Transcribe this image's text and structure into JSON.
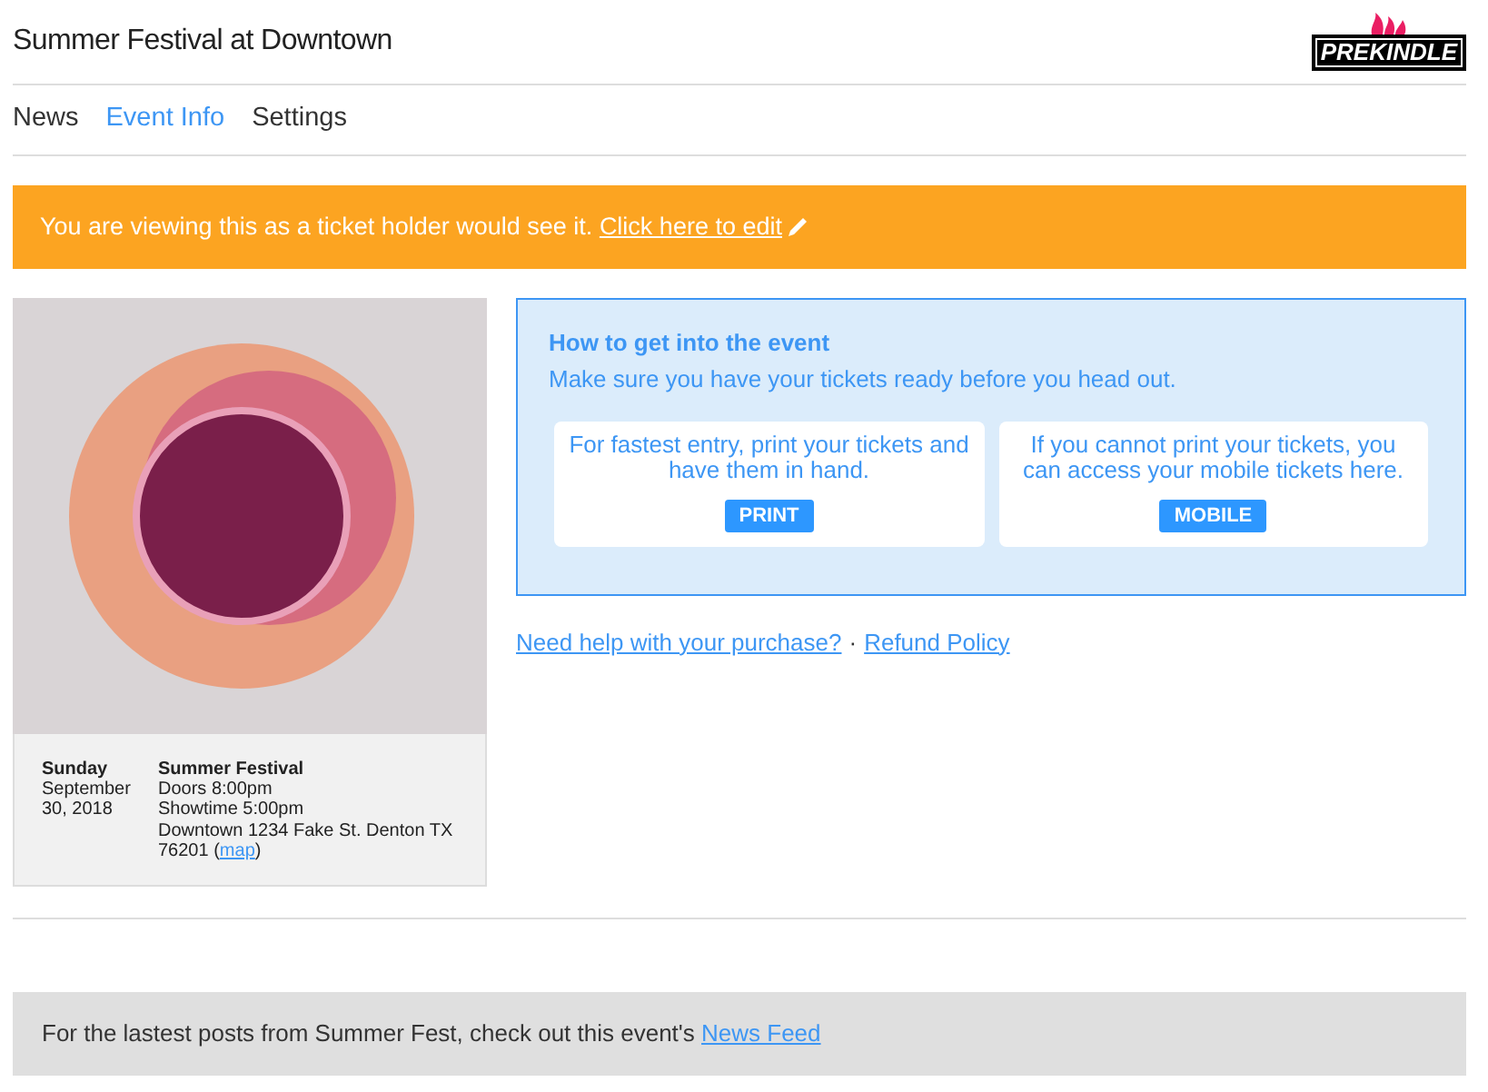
{
  "header": {
    "title": "Summer Festival at Downtown",
    "logo": "PREKINDLE"
  },
  "tabs": [
    {
      "label": "News",
      "selected": false
    },
    {
      "label": "Event Info",
      "selected": true
    },
    {
      "label": "Settings",
      "selected": false
    }
  ],
  "banner": {
    "text": "You are viewing this as a ticket holder would see it.",
    "link": "Click here to edit"
  },
  "event_card": {
    "day": "Sunday",
    "date": "September 30, 2018",
    "name": "Summer Festival",
    "doors": "Doors 8:00pm",
    "showtime": "Showtime 5:00pm",
    "address": "Downtown 1234 Fake St. Denton TX 76201 (",
    "map_link": "map",
    "address_end": ")"
  },
  "entry_panel": {
    "title": "How to get into the event",
    "subtitle": "Make sure you have your tickets ready before you head out.",
    "options": [
      {
        "text": "For fastest entry, print your tickets and have them in hand.",
        "button": "PRINT"
      },
      {
        "text": "If you cannot print your tickets, you can access your mobile tickets here.",
        "button": "MOBILE"
      }
    ]
  },
  "help_links": {
    "help": "Need help with your purchase?",
    "separator": "·",
    "refund": "Refund Policy"
  },
  "footer": {
    "text": "For the lastest posts from Summer Fest, check out this event's",
    "link": "News Feed"
  }
}
